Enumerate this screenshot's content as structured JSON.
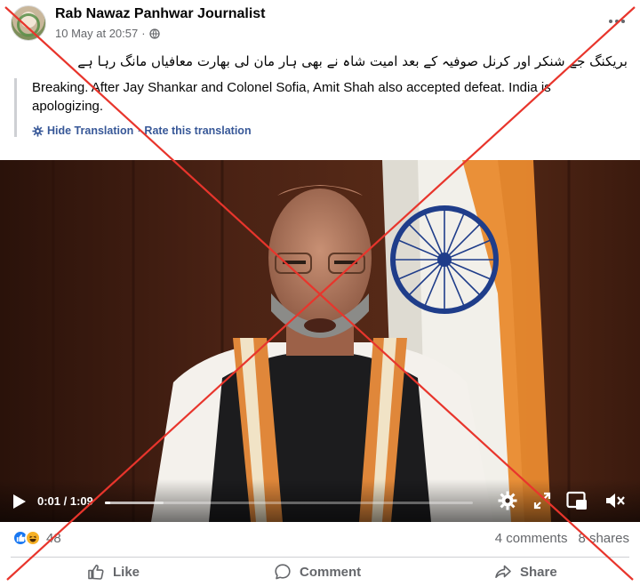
{
  "post": {
    "author": "Rab Nawaz Panhwar Journalist",
    "date": "10 May at 20:57",
    "separator": "·",
    "privacy_icon": "globe-icon",
    "more_icon": "more-options-icon",
    "urdu_text": "بریکنگ جے شنکر اور کرنل صوفیہ کے بعد امیت شاہ نے بھی ہار مان لی بھارت معافیاں مانگ رہا ہے",
    "translation": "Breaking. After Jay Shankar and Colonel Sofia, Amit Shah also accepted defeat. India is apologizing.",
    "hide_translation": "Hide Translation",
    "dot": "·",
    "rate_translation": "Rate this translation"
  },
  "video": {
    "time": "0:01 / 1:09",
    "progress": 0.014,
    "buffered": 0.16,
    "icons": [
      "play-icon",
      "settings-icon",
      "fullscreen-icon",
      "picture-in-picture-icon",
      "muted-icon"
    ]
  },
  "stats": {
    "reactions": [
      "like",
      "haha"
    ],
    "reaction_count": "48",
    "comments": "4 comments",
    "shares": "8 shares"
  },
  "actions": {
    "like": "Like",
    "comment": "Comment",
    "share": "Share"
  },
  "colors": {
    "link": "#385898",
    "secondary_text": "#65676b",
    "like_blue": "#1877f2",
    "cross_red": "#e8352c"
  }
}
